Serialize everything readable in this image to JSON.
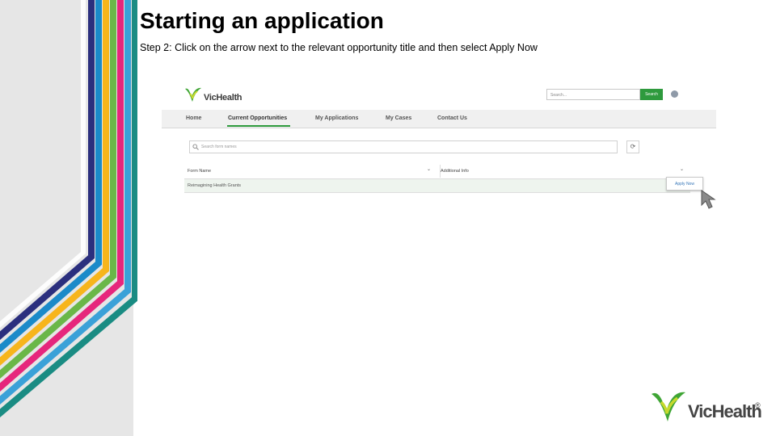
{
  "slide": {
    "title": "Starting an application",
    "subtitle": "Step 2: Click on the arrow next to the relevant opportunity title and then select Apply Now"
  },
  "screenshot": {
    "brand": "VicHealth",
    "search_placeholder": "Search...",
    "search_button": "Search",
    "nav": [
      "Home",
      "Current Opportunities",
      "My Applications",
      "My Cases",
      "Contact Us"
    ],
    "filter_placeholder": "Search form names",
    "refresh_glyph": "⟳",
    "table": {
      "headers": [
        "Form Name",
        "Additional Info"
      ],
      "rows": [
        [
          "Reimagining Health Grants",
          ""
        ]
      ]
    },
    "apply_now": "Apply Now",
    "chevron_glyph": "⌄"
  },
  "footer": {
    "brand": "VicHealth",
    "tm": "®"
  },
  "colors": {
    "stripes": [
      "#2b2f7e",
      "#1b8ac9",
      "#f7b51c",
      "#6ab748",
      "#e6267c",
      "#3aa1d8",
      "#1a8c83"
    ],
    "brand_green": "#2e9a3d",
    "sidebar_bg": "#e6e6e6"
  },
  "icons": [
    "vichealth-logo-icon",
    "user-icon",
    "search-icon",
    "refresh-icon",
    "chevron-down-icon",
    "mouse-cursor-icon"
  ]
}
